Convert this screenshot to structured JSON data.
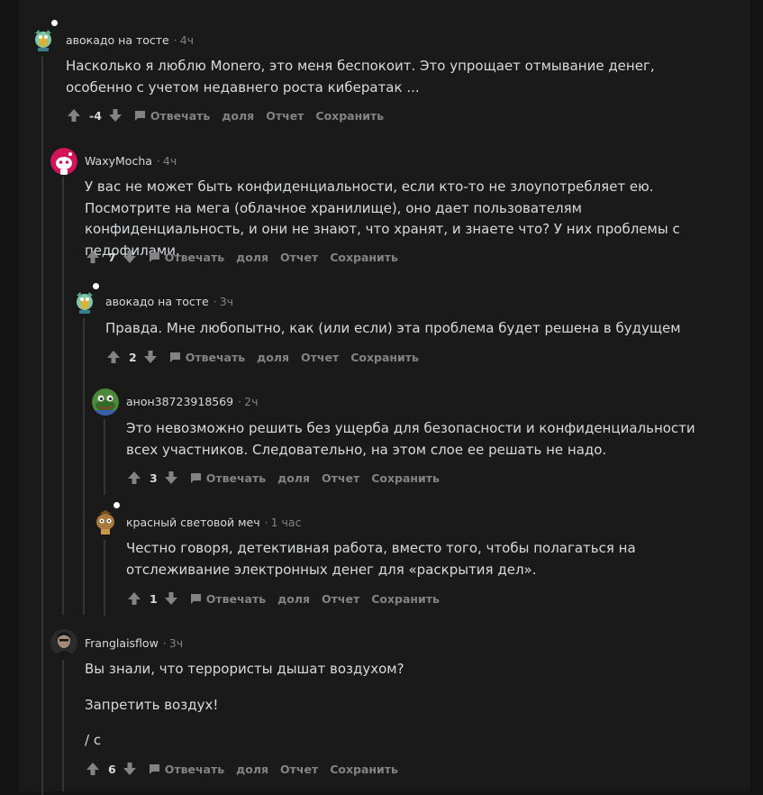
{
  "actions": {
    "reply": "Отвечать",
    "share": "доля",
    "report": "Отчет",
    "save": "Сохранить"
  },
  "comments": [
    {
      "author": "авокадо на тосте",
      "time": "4ч",
      "avatar": "avocado-avatar",
      "paragraphs": [
        "Насколько я люблю Monero, это меня беспокоит. Это упрощает отмывание денег, особенно с учетом недавнего роста кибератак ..."
      ],
      "score": "-4"
    },
    {
      "author": "WaxyMocha",
      "time": "4ч",
      "avatar": "pink-snoo-avatar",
      "paragraphs": [
        "У вас не может быть конфиденциальности, если кто-то не злоупотребляет ею. Посмотрите на мега (облачное хранилище), оно дает пользователям конфиденциальность, и они не знают, что хранят, и знаете что? У них проблемы с педофилами."
      ],
      "score": "7"
    },
    {
      "author": "авокадо на тосте",
      "time": "3ч",
      "avatar": "avocado-avatar",
      "paragraphs": [
        "Правда. Мне любопытно, как (или если) эта проблема будет решена в будущем"
      ],
      "score": "2"
    },
    {
      "author": "анон38723918569",
      "time": "2ч",
      "avatar": "frog-avatar",
      "paragraphs": [
        "Это невозможно решить без ущерба для безопасности и конфиденциальности всех участников. Следовательно, на этом слое ее решать не надо."
      ],
      "score": "3"
    },
    {
      "author": "красный световой меч",
      "time": "1 час",
      "avatar": "brown-snoo-avatar",
      "paragraphs": [
        "Честно говоря, детективная работа, вместо того, чтобы полагаться на отслеживание электронных денег для «раскрытия дел»."
      ],
      "score": "1"
    },
    {
      "author": "Franglaisflow",
      "time": "3ч",
      "avatar": "photo-avatar",
      "paragraphs": [
        "Вы знали, что террористы дышат воздухом?",
        "Запретить воздух!",
        "/ с"
      ],
      "score": "6"
    }
  ]
}
